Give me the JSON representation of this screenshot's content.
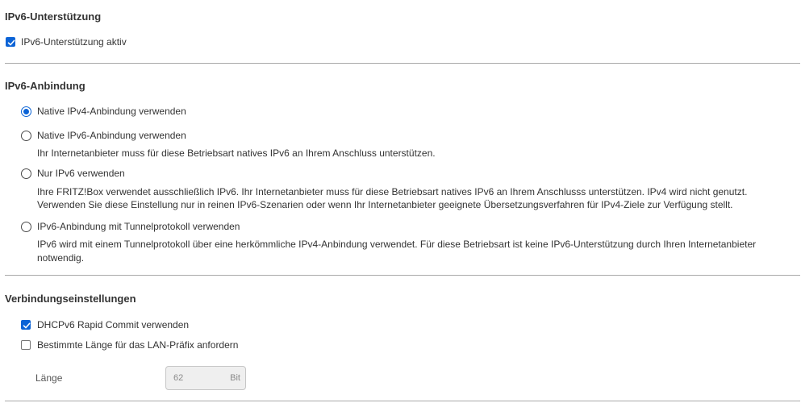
{
  "sections": {
    "support": {
      "title": "IPv6-Unterstützung",
      "checkbox_label": "IPv6-Unterstützung aktiv",
      "checked": true
    },
    "binding": {
      "title": "IPv6-Anbindung",
      "options": [
        {
          "label": "Native IPv4-Anbindung verwenden",
          "selected": true,
          "description": []
        },
        {
          "label": "Native IPv6-Anbindung verwenden",
          "selected": false,
          "description": [
            "Ihr Internetanbieter muss für diese Betriebsart natives IPv6 an Ihrem Anschluss unterstützen."
          ]
        },
        {
          "label": "Nur IPv6 verwenden",
          "selected": false,
          "description": [
            "Ihre FRITZ!Box verwendet ausschließlich IPv6. Ihr Internetanbieter muss für diese Betriebsart natives IPv6 an Ihrem Anschlusss unterstützen. IPv4 wird nicht genutzt.",
            "Verwenden Sie diese Einstellung nur in reinen IPv6-Szenarien oder wenn Ihr Internetanbieter geeignete Übersetzungsverfahren für IPv4-Ziele zur Verfügung stellt."
          ]
        },
        {
          "label": "IPv6-Anbindung mit Tunnelprotokoll verwenden",
          "selected": false,
          "description": [
            "IPv6 wird mit einem Tunnelprotokoll über eine herkömmliche IPv4-Anbindung verwendet. Für diese Betriebsart ist keine IPv6-Unterstützung durch Ihren Internetanbieter",
            "notwendig."
          ]
        }
      ]
    },
    "connection": {
      "title": "Verbindungseinstellungen",
      "rapid_commit_label": "DHCPv6 Rapid Commit verwenden",
      "rapid_commit_checked": true,
      "prefix_label": "Bestimmte Länge für das LAN-Präfix anfordern",
      "prefix_checked": false,
      "length_label": "Länge",
      "length_value": "62",
      "length_unit": "Bit"
    }
  },
  "colors": {
    "accent": "#0b63d6",
    "divider": "#a9a9a9",
    "text": "#333333"
  }
}
